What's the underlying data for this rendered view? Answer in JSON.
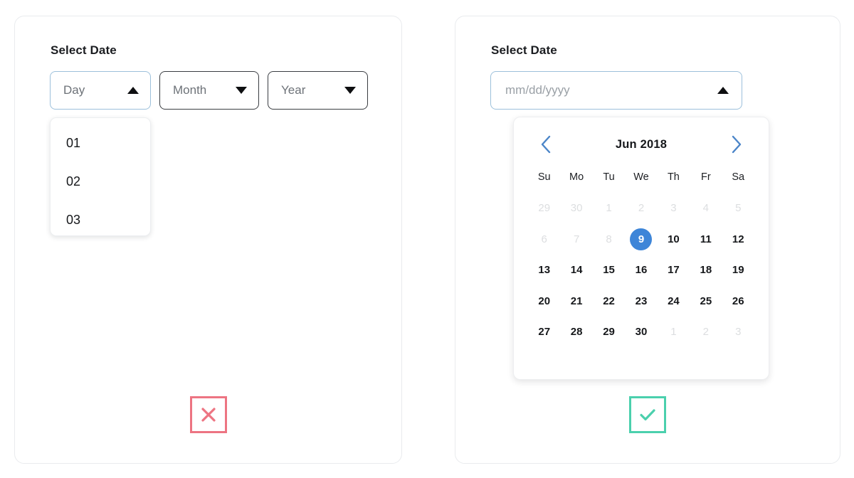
{
  "panels": {
    "bad": {
      "heading": "Select Date",
      "selects": [
        {
          "label": "Day",
          "arrow_icon": "triangle-up-icon",
          "state": "open"
        },
        {
          "label": "Month",
          "arrow_icon": "triangle-down-icon",
          "state": "closed"
        },
        {
          "label": "Year",
          "arrow_icon": "triangle-down-icon",
          "state": "closed"
        }
      ],
      "day_options": [
        "01",
        "02",
        "03"
      ],
      "verdict": {
        "icon": "cross-icon",
        "color": "#ed7482",
        "meaning": "incorrect"
      }
    },
    "good": {
      "heading": "Select Date",
      "input": {
        "placeholder": "mm/dd/yyyy",
        "value": "",
        "arrow_icon": "triangle-up-icon",
        "state": "open"
      },
      "calendar": {
        "title": "Jun 2018",
        "prev_icon": "chevron-left-icon",
        "next_icon": "chevron-right-icon",
        "weekdays": [
          "Su",
          "Mo",
          "Tu",
          "We",
          "Th",
          "Fr",
          "Sa"
        ],
        "selected_day": 9,
        "accent_color": "#3d85d8",
        "weeks": [
          [
            {
              "label": "29",
              "muted": true
            },
            {
              "label": "30",
              "muted": true
            },
            {
              "label": "1",
              "muted": true
            },
            {
              "label": "2",
              "muted": true
            },
            {
              "label": "3",
              "muted": true
            },
            {
              "label": "4",
              "muted": true
            },
            {
              "label": "5",
              "muted": true
            }
          ],
          [
            {
              "label": "6",
              "muted": true
            },
            {
              "label": "7",
              "muted": true
            },
            {
              "label": "8",
              "muted": true
            },
            {
              "label": "9",
              "muted": false,
              "selected": true
            },
            {
              "label": "10",
              "muted": false
            },
            {
              "label": "11",
              "muted": false
            },
            {
              "label": "12",
              "muted": false
            }
          ],
          [
            {
              "label": "13",
              "muted": false
            },
            {
              "label": "14",
              "muted": false
            },
            {
              "label": "15",
              "muted": false
            },
            {
              "label": "16",
              "muted": false
            },
            {
              "label": "17",
              "muted": false
            },
            {
              "label": "18",
              "muted": false
            },
            {
              "label": "19",
              "muted": false
            }
          ],
          [
            {
              "label": "20",
              "muted": false
            },
            {
              "label": "21",
              "muted": false
            },
            {
              "label": "22",
              "muted": false
            },
            {
              "label": "23",
              "muted": false
            },
            {
              "label": "24",
              "muted": false
            },
            {
              "label": "25",
              "muted": false
            },
            {
              "label": "26",
              "muted": false
            }
          ],
          [
            {
              "label": "27",
              "muted": false
            },
            {
              "label": "28",
              "muted": false
            },
            {
              "label": "29",
              "muted": false
            },
            {
              "label": "30",
              "muted": false
            },
            {
              "label": "1",
              "muted": true
            },
            {
              "label": "2",
              "muted": true
            },
            {
              "label": "3",
              "muted": true
            }
          ]
        ]
      },
      "verdict": {
        "icon": "check-icon",
        "color": "#4bd0ad",
        "meaning": "correct"
      }
    }
  }
}
